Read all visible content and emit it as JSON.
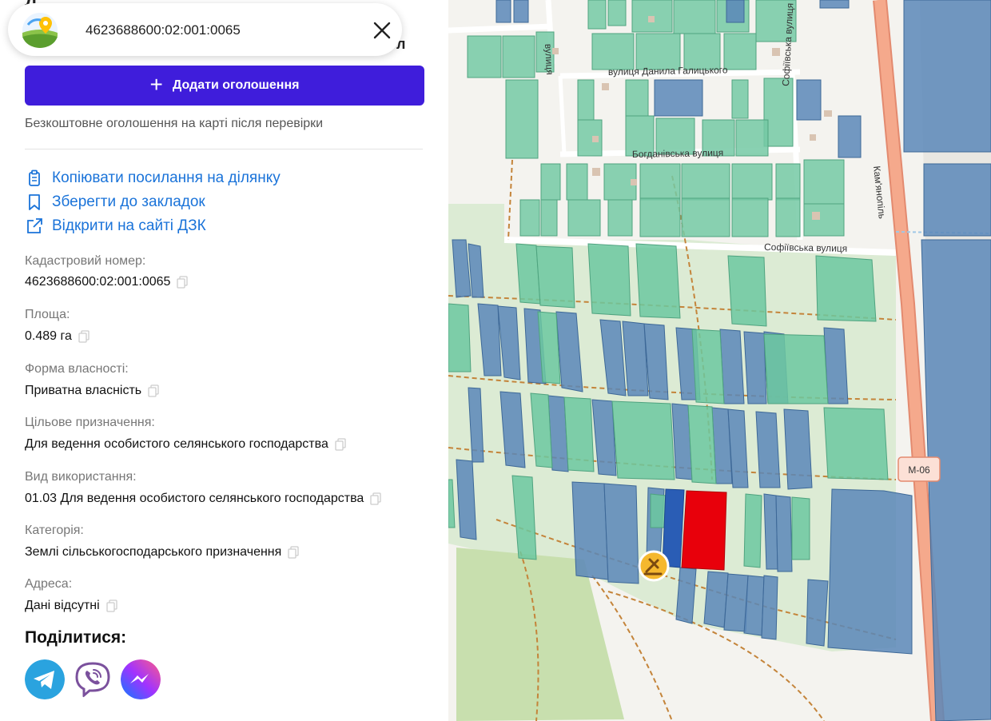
{
  "search": {
    "query": "4623688600:02:001:0065"
  },
  "add_ad": {
    "label": "Додати оголошення",
    "note": "Безкоштовне оголошення на карті після перевірки"
  },
  "actions": {
    "copy_link": "Копіювати посилання на ділянку",
    "bookmark": "Зберегти до закладок",
    "open_dzk": "Відкрити на сайті ДЗК"
  },
  "fields": [
    {
      "label": "Кадастровий номер:",
      "value": "4623688600:02:001:0065"
    },
    {
      "label": "Площа:",
      "value": "0.489 га"
    },
    {
      "label": "Форма власності:",
      "value": "Приватна власність"
    },
    {
      "label": "Цільове призначення:",
      "value": "Для ведення особистого селянського господарства"
    },
    {
      "label": "Вид використання:",
      "value": "01.03 Для ведення особистого селянського господарства"
    },
    {
      "label": "Категорія:",
      "value": "Землі сільськогосподарського призначення"
    },
    {
      "label": "Адреса:",
      "value": "Дані відсутні"
    }
  ],
  "share": {
    "title": "Поділитися:",
    "services": [
      "telegram",
      "viber",
      "messenger"
    ]
  },
  "map": {
    "streets": {
      "danyla": "вулиця Данила Галицького",
      "bohdanivska": "Богданівська вулиця",
      "sofiivska": "Софіївська вулиця",
      "sofiivska_vertical": "Софіївська вулиця",
      "vertical_top": "вулиця",
      "kamianopil": "Кам'янопіль",
      "highway": "М-06"
    },
    "colors": {
      "selected_parcel": "#e8000b",
      "accent": "#3f1ddb",
      "link": "#1a73d9",
      "highway": "#f29a7b",
      "parcel_green": "#6cc8a0",
      "parcel_blue": "#5b87b8"
    },
    "marker_icon": "auction-gavel-icon"
  }
}
